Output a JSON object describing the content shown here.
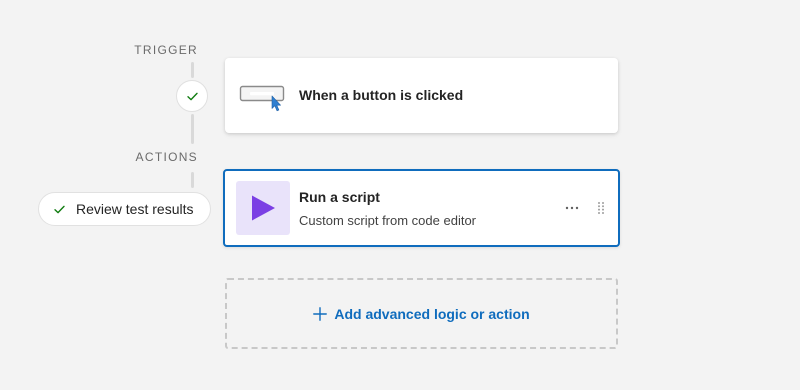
{
  "flow": {
    "trigger_section_label": "TRIGGER",
    "actions_section_label": "ACTIONS"
  },
  "trigger": {
    "title": "When a button is clicked",
    "icon": "button-click-icon"
  },
  "review": {
    "label": "Review test results",
    "icon": "checkmark-icon"
  },
  "action": {
    "title": "Run a script",
    "subtitle": "Custom script from code editor",
    "icon": "play-icon",
    "more_label": "···"
  },
  "add_action": {
    "label": "Add advanced logic or action",
    "icon": "plus-icon"
  },
  "colors": {
    "accent": "#0f6cbd",
    "success": "#107c10",
    "script_tile": "#e9e3fa",
    "script_play": "#7b3fe4",
    "background": "#f3f3f3"
  }
}
